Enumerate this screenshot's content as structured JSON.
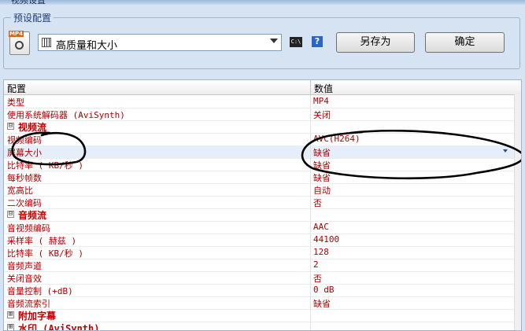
{
  "window": {
    "title": "视频设置"
  },
  "preset": {
    "group_title": "预设配置",
    "format_badge": "MP4",
    "selected_value": "高质量和大小",
    "cmd_label": "C:\\",
    "help_label": "?",
    "save_as_label": "另存为",
    "ok_label": "确定"
  },
  "grid": {
    "header_name": "配置",
    "header_value": "数值",
    "rows": [
      {
        "name": "类型",
        "value": "MP4"
      },
      {
        "name": "使用系统解码器 (AviSynth)",
        "value": "关闭"
      },
      {
        "name": "视频流",
        "value": "",
        "category": true,
        "expand": "⊟"
      },
      {
        "name": "视频编码",
        "value": "AVC(H264)"
      },
      {
        "name": "屏幕大小",
        "value": "缺省",
        "selected": true
      },
      {
        "name": "比特率 ( KB/秒 )",
        "value": "缺省"
      },
      {
        "name": "每秒帧数",
        "value": "缺省"
      },
      {
        "name": "宽高比",
        "value": "自动"
      },
      {
        "name": "二次编码",
        "value": "否"
      },
      {
        "name": "音频流",
        "value": "",
        "category": true,
        "expand": "⊟"
      },
      {
        "name": "音视频编码",
        "value": "AAC"
      },
      {
        "name": "采样率 ( 赫兹 )",
        "value": "44100"
      },
      {
        "name": "比特率 ( KB/秒 )",
        "value": "128"
      },
      {
        "name": "音频声道",
        "value": "2"
      },
      {
        "name": "关闭音效",
        "value": "否"
      },
      {
        "name": "音量控制 (+dB)",
        "value": "0 dB"
      },
      {
        "name": "音频流索引",
        "value": "缺省"
      },
      {
        "name": "附加字幕",
        "value": "",
        "category": true,
        "expand": "⊞"
      },
      {
        "name": "水印 (AviSynth)",
        "value": "",
        "category": true,
        "expand": "⊞"
      }
    ]
  },
  "colors": {
    "property_text": "#b00000",
    "category_text": "#c00000",
    "annotation_ink": "#000000"
  }
}
